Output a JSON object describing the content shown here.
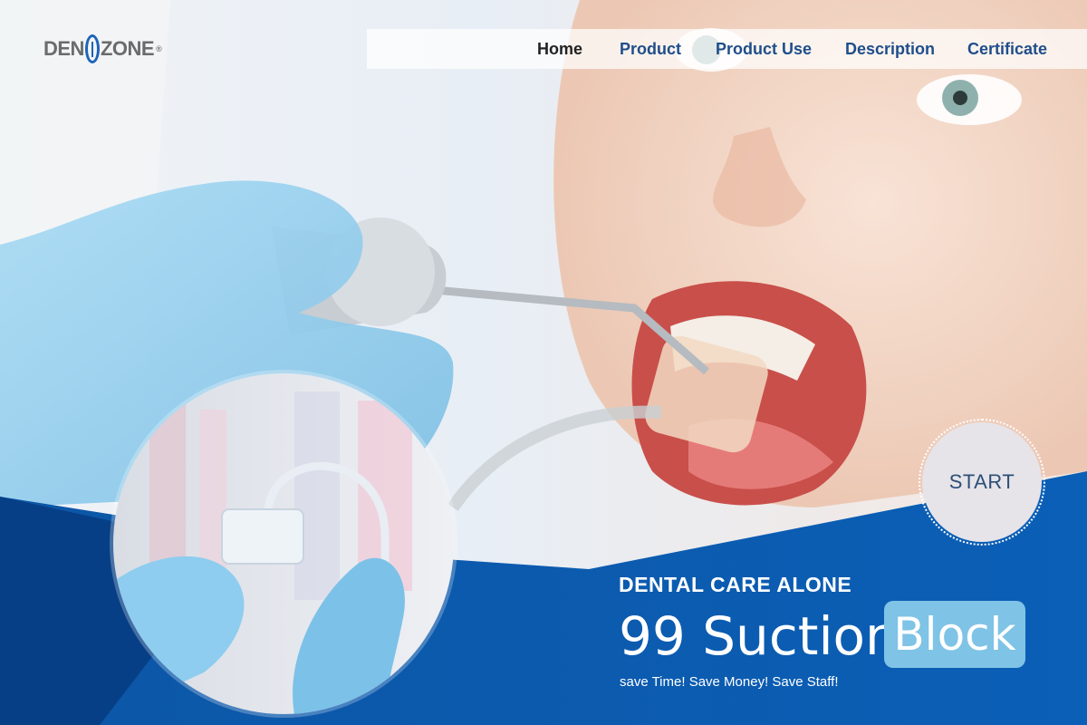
{
  "brand": {
    "logo_left": "DEN",
    "logo_right": "ZONE",
    "registered_mark": "®"
  },
  "nav": {
    "items": [
      {
        "label": "Home",
        "active": true
      },
      {
        "label": "Product"
      },
      {
        "label": "Product Use"
      },
      {
        "label": "Description"
      },
      {
        "label": "Certificate"
      }
    ]
  },
  "hero": {
    "start_label": "START",
    "tagline": "DENTAL CARE ALONE",
    "headline": "99 Suction",
    "headline_badge": "Block",
    "subtagline": "save Time! Save Money! Save Staff!"
  },
  "colors": {
    "brand_blue": "#0b5cb0",
    "dark_blue": "#073f86",
    "nav_text": "#1f4e8a",
    "badge": "#7fc3e6",
    "glove": "#8ecdef"
  }
}
